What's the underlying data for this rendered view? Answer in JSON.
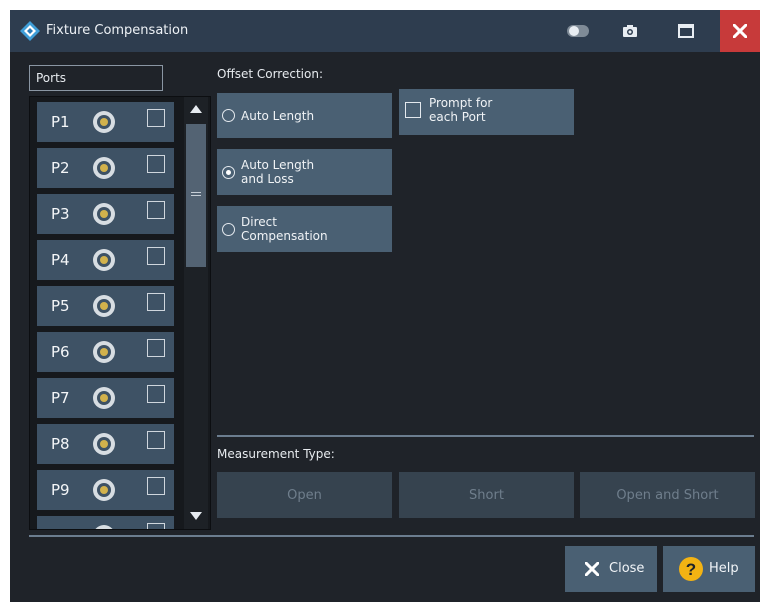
{
  "window": {
    "title": "Fixture Compensation"
  },
  "ports": {
    "title": "Ports",
    "items": [
      "P1",
      "P2",
      "P3",
      "P4",
      "P5",
      "P6",
      "P7",
      "P8",
      "P9"
    ]
  },
  "offset": {
    "label": "Offset Correction:",
    "options": [
      {
        "line1": "Auto Length",
        "line2": "",
        "selected": false
      },
      {
        "line1": "Auto Length",
        "line2": "and Loss",
        "selected": true
      },
      {
        "line1": "Direct",
        "line2": "Compensation",
        "selected": false
      }
    ],
    "prompt": {
      "line1": "Prompt for",
      "line2": "each Port",
      "checked": false
    }
  },
  "measurement": {
    "label": "Measurement Type:",
    "buttons": [
      "Open",
      "Short",
      "Open and Short"
    ]
  },
  "footer": {
    "close_label": "Close",
    "help_label": "Help"
  },
  "colors": {
    "titlebar": "#2e3d4f",
    "panel": "#1f2329",
    "button": "#4a6073",
    "close_accent": "#c73a3a",
    "help_icon": "#f3b313"
  }
}
